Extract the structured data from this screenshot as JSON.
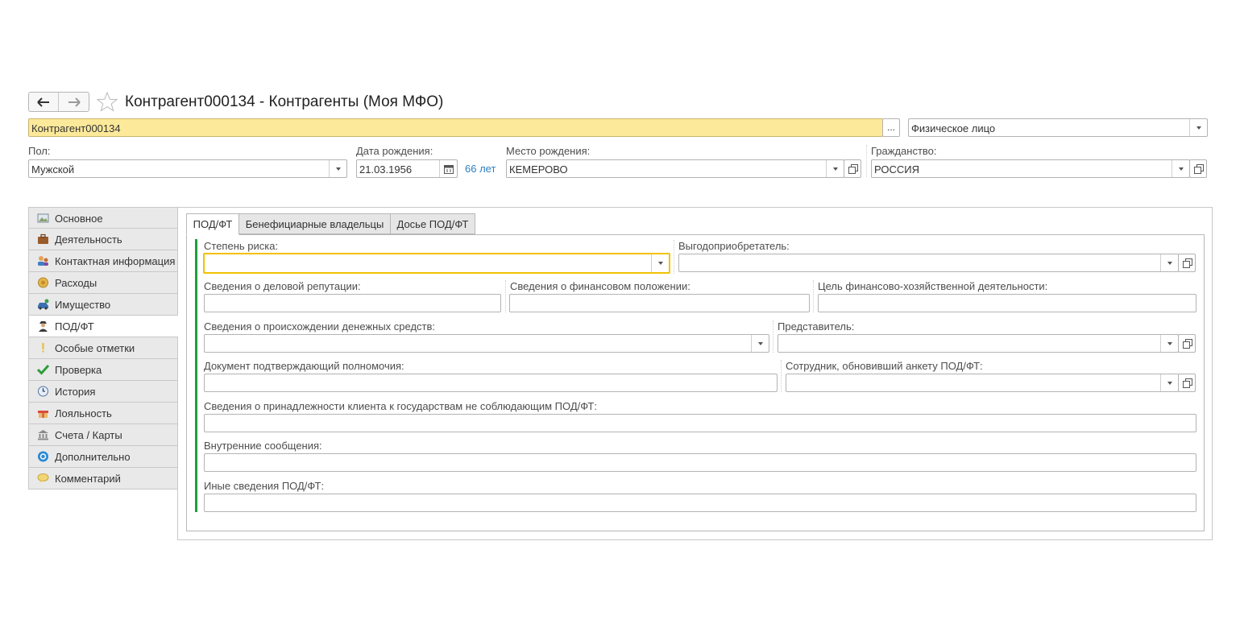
{
  "window": {
    "title": "Контрагент000134 - Контрагенты (Моя МФО)"
  },
  "header": {
    "name_value": "Контрагент000134",
    "more_button": "...",
    "type_value": "Физическое лицо"
  },
  "personal": {
    "gender_label": "Пол:",
    "gender_value": "Мужской",
    "birthdate_label": "Дата рождения:",
    "birthdate_value": "21.03.1956",
    "age_link": "66 лет",
    "birthplace_label": "Место рождения:",
    "birthplace_value": "КЕМЕРОВО",
    "citizenship_label": "Гражданство:",
    "citizenship_value": "РОССИЯ"
  },
  "sidebar": {
    "items": [
      {
        "label": "Основное",
        "icon": "image-icon"
      },
      {
        "label": "Деятельность",
        "icon": "briefcase-icon"
      },
      {
        "label": "Контактная информация",
        "icon": "contacts-icon"
      },
      {
        "label": "Расходы",
        "icon": "coins-icon"
      },
      {
        "label": "Имущество",
        "icon": "car-icon"
      },
      {
        "label": "ПОД/ФТ",
        "icon": "spy-icon"
      },
      {
        "label": "Особые отметки",
        "icon": "exclamation-icon"
      },
      {
        "label": "Проверка",
        "icon": "checkmark-icon"
      },
      {
        "label": "История",
        "icon": "clock-icon"
      },
      {
        "label": "Лояльность",
        "icon": "gift-icon"
      },
      {
        "label": "Счета / Карты",
        "icon": "bank-icon"
      },
      {
        "label": "Дополнительно",
        "icon": "gear-icon"
      },
      {
        "label": "Комментарий",
        "icon": "comment-icon"
      }
    ],
    "active_index": 5
  },
  "tabs": [
    {
      "label": "ПОД/ФТ"
    },
    {
      "label": "Бенефициарные владельцы"
    },
    {
      "label": "Досье ПОД/ФТ"
    }
  ],
  "form": {
    "risk_label": "Степень риска:",
    "beneficiary_label": "Выгодоприобретатель:",
    "reputation_label": "Сведения о деловой репутации:",
    "financial_label": "Сведения о финансовом положении:",
    "goal_label": "Цель финансово-хозяйственной деятельности:",
    "funds_origin_label": "Сведения о происхождении денежных средств:",
    "representative_label": "Представитель:",
    "authority_doc_label": "Документ подтверждающий полномочия:",
    "employee_label": "Сотрудник, обновивший анкету ПОД/ФТ:",
    "states_label": "Сведения о принадлежности клиента к государствам не соблюдающим ПОД/ФТ:",
    "internal_label": "Внутренние сообщения:",
    "other_label": "Иные сведения ПОД/ФТ:"
  },
  "colors": {
    "highlight_field": "#fde99a",
    "focus_border": "#f2c200",
    "link": "#2e7ec3",
    "green_bar": "#1f9e3a"
  }
}
